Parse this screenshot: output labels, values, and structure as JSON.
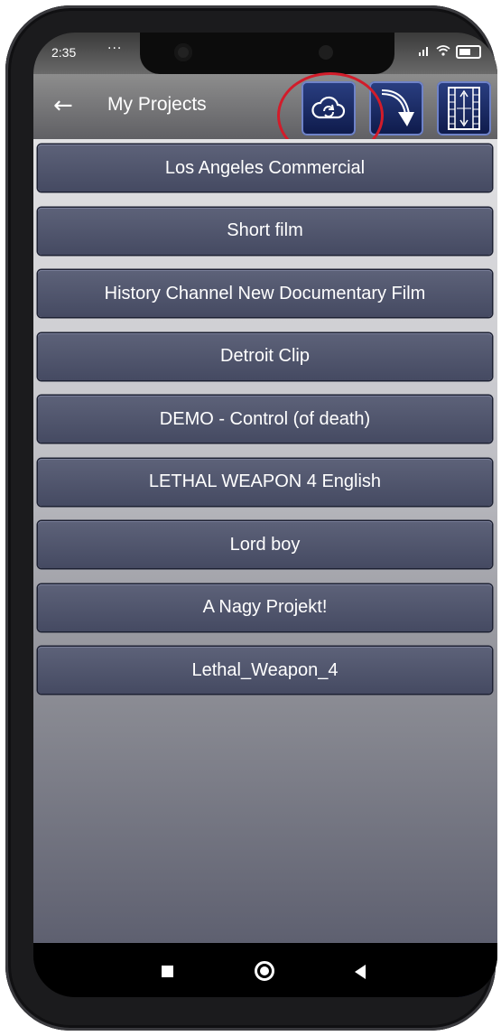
{
  "status_bar": {
    "time": "2:35",
    "dots": "···"
  },
  "app_bar": {
    "title": "My Projects",
    "buttons": [
      {
        "name": "cloud-sync-button",
        "icon": "cloud-sync-icon"
      },
      {
        "name": "curve-transition-button",
        "icon": "curve-arrow-icon"
      },
      {
        "name": "film-strip-button",
        "icon": "film-strip-icon"
      }
    ]
  },
  "projects": [
    "Los Angeles Commercial",
    "Short film",
    "History Channel New Documentary Film",
    "Detroit Clip",
    "DEMO - Control (of death)",
    "LETHAL WEAPON 4 English",
    "Lord boy",
    "A Nagy Projekt!",
    "Lethal_Weapon_4"
  ],
  "fab_label": "+",
  "colors": {
    "accent": "#25356f",
    "item_bg": "#4f546b",
    "highlight": "#d21c2a"
  }
}
